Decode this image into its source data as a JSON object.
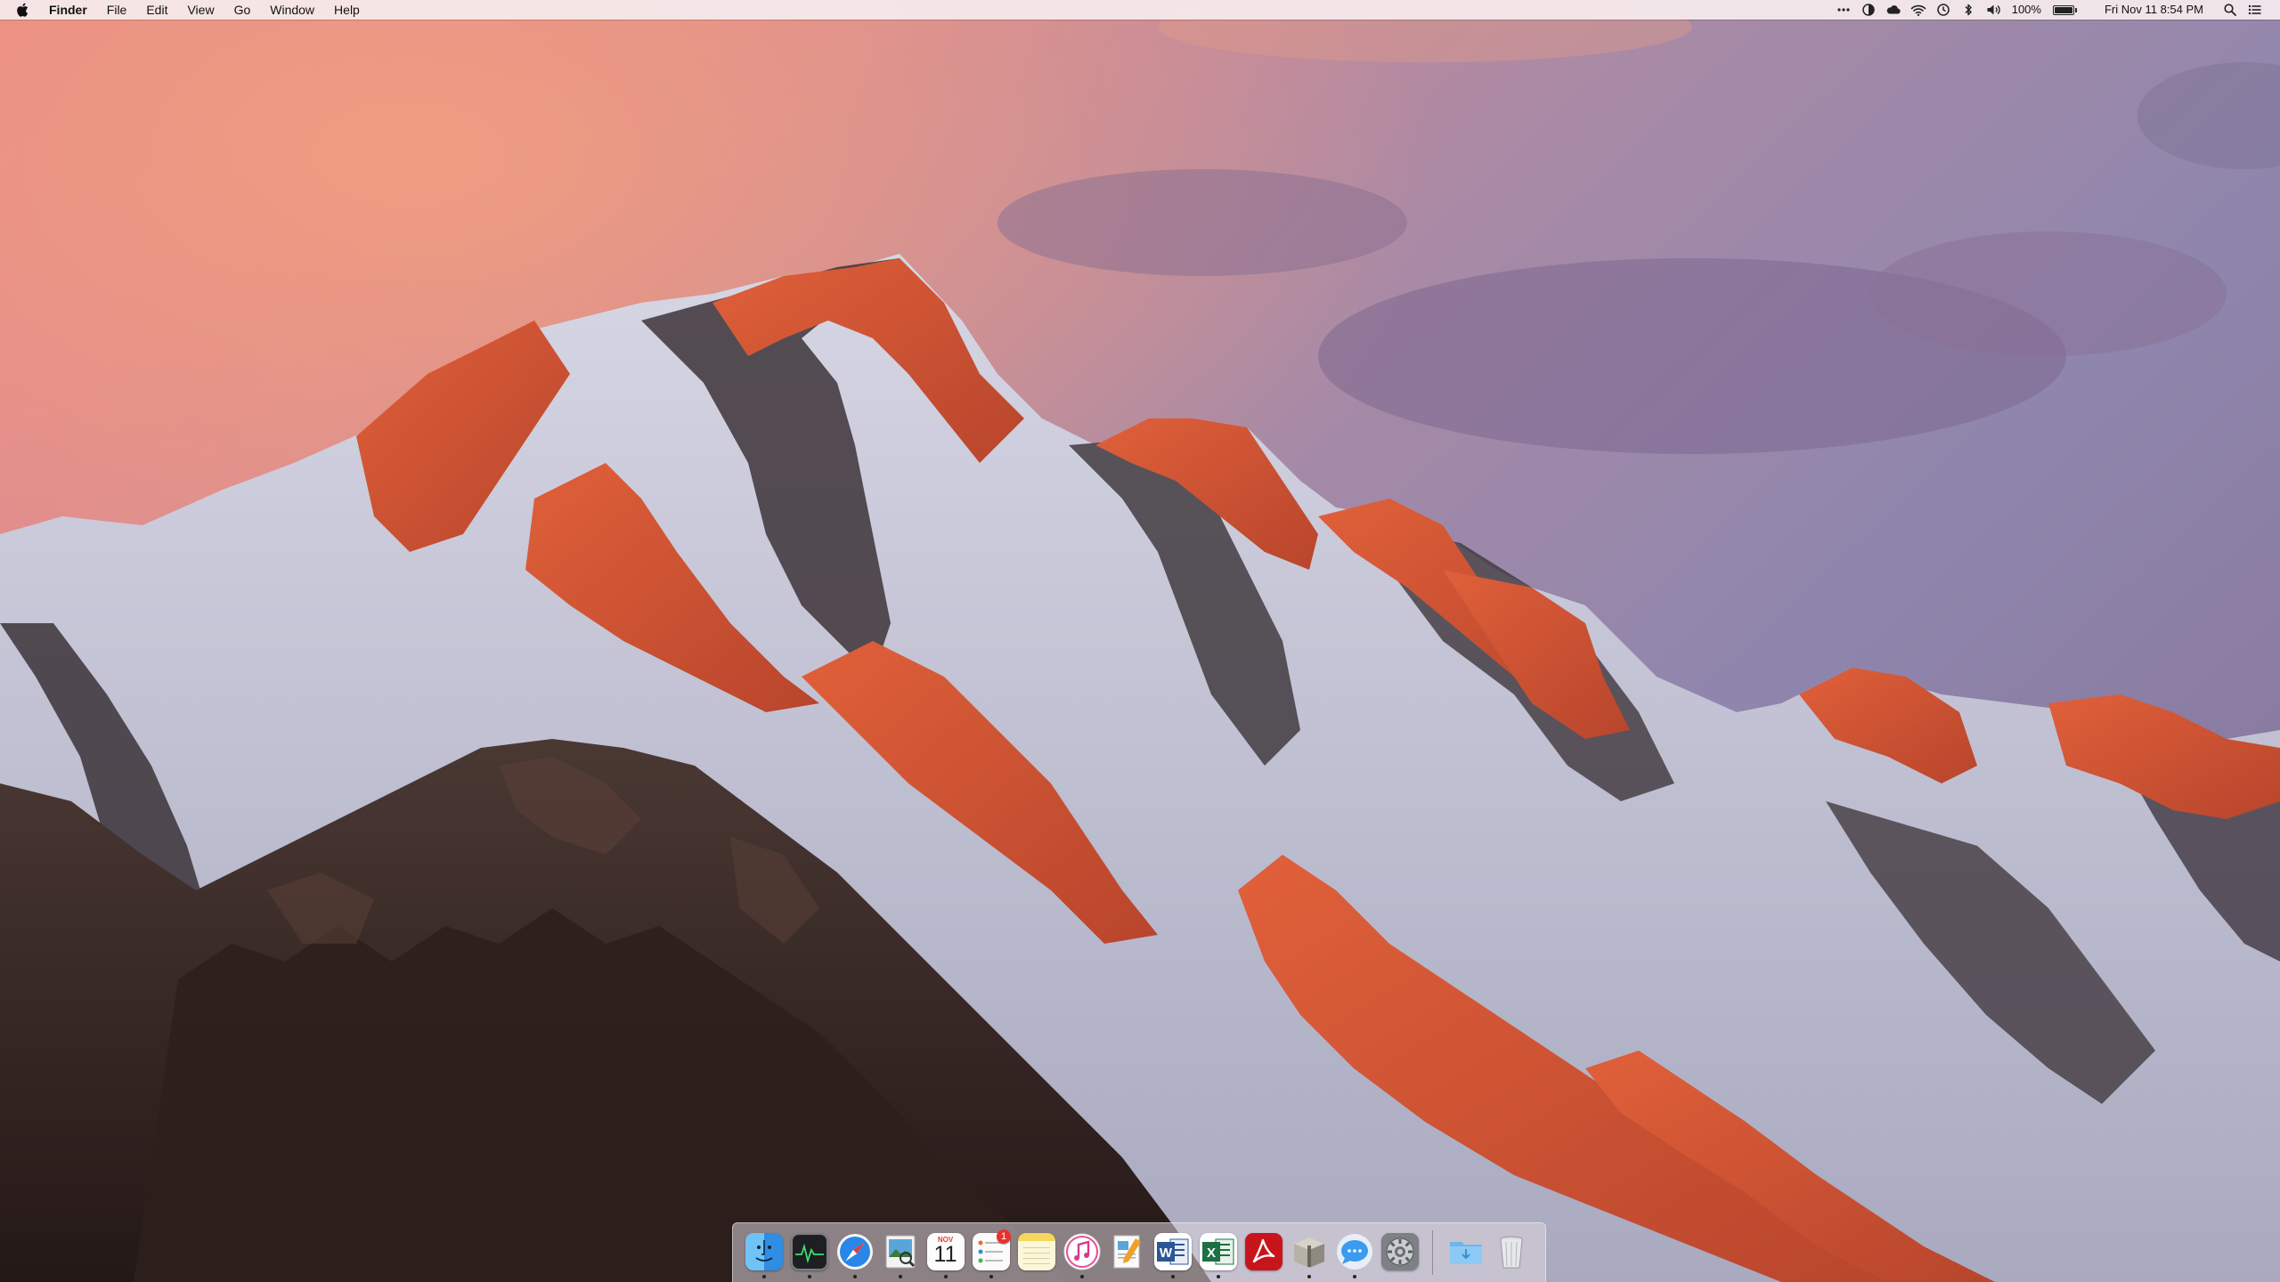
{
  "menubar": {
    "app_name": "Finder",
    "menus": [
      "File",
      "Edit",
      "View",
      "Go",
      "Window",
      "Help"
    ],
    "status": {
      "battery_percent": "100%",
      "battery_level": 1.0,
      "datetime": "Fri Nov 11  8:54 PM"
    }
  },
  "dock": {
    "apps": [
      {
        "name": "Finder",
        "running": true
      },
      {
        "name": "Activity Monitor",
        "running": true
      },
      {
        "name": "Safari",
        "running": true
      },
      {
        "name": "Preview",
        "running": true
      },
      {
        "name": "Calendar",
        "running": true,
        "month": "NOV",
        "day": "11"
      },
      {
        "name": "Reminders",
        "running": true,
        "badge": "1"
      },
      {
        "name": "Notes",
        "running": false
      },
      {
        "name": "iTunes",
        "running": true
      },
      {
        "name": "Pages",
        "running": false
      },
      {
        "name": "Microsoft Word",
        "running": true
      },
      {
        "name": "Microsoft Excel",
        "running": true
      },
      {
        "name": "Acrobat",
        "running": false
      },
      {
        "name": "Archive Utility",
        "running": true
      },
      {
        "name": "Messages",
        "running": true
      },
      {
        "name": "System Preferences",
        "running": false
      }
    ],
    "right": [
      {
        "name": "Downloads"
      },
      {
        "name": "Trash"
      }
    ]
  },
  "colors": {
    "menubar_bg": "#f6ecee",
    "dock_bg": "#dcd6dc",
    "badge": "#e8322d"
  }
}
